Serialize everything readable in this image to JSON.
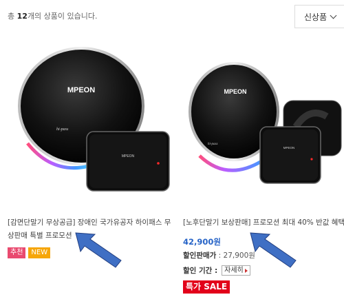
{
  "header": {
    "count_prefix": "총",
    "count_number": "12",
    "count_suffix": "개의 상품이 있습니다.",
    "sort_selected": "신상품"
  },
  "products": [
    {
      "image_brand": "MPEON",
      "image_sub_label": "hi-pass",
      "name": "[감면단말기 무상공급] 장애인 국가유공자 하이패스 무상판매 특별 프로모션",
      "badges": [
        "추천",
        "NEW"
      ]
    },
    {
      "image_brand": "MPEON",
      "image_sub_label": "hi-pass",
      "name": "[노후단말기 보상판매] 프로모션 최대 40% 반값 혜택",
      "price": "42,900원",
      "sale_label": "할인판매가",
      "sale_value": " : 27,900원",
      "period_label": "할인 기간 :",
      "detail_button": "자세히",
      "special_tag": "특가 SALE"
    }
  ],
  "colors": {
    "price": "#2764c7",
    "badge_recommend": "#e94a6f",
    "badge_new": "#f6a609",
    "special_tag": "#e2001a",
    "arrow": "#3f6fc4"
  }
}
